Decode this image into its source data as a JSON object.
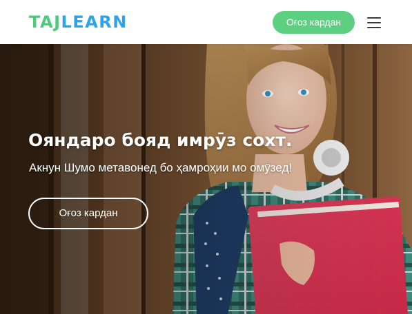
{
  "header": {
    "logo": {
      "part_a": "TAJ",
      "part_b": "LEARN"
    },
    "cta_label": "Оғоз кардан",
    "menu_icon": "hamburger-menu-icon"
  },
  "hero": {
    "title": "Ояндаро бояд имрӯз сохт.",
    "subtitle": "Акнун Шумо метавонед бо ҳамроҳии мо омӯзед!",
    "cta_label": "Оғоз кардан",
    "image": "student-girl-holding-red-folder-photo"
  },
  "colors": {
    "brand_green": "#4fc97b",
    "brand_blue": "#2aa3e8",
    "button_green": "#5ccf80",
    "header_bg": "#ffffff",
    "hero_text": "#ffffff"
  }
}
